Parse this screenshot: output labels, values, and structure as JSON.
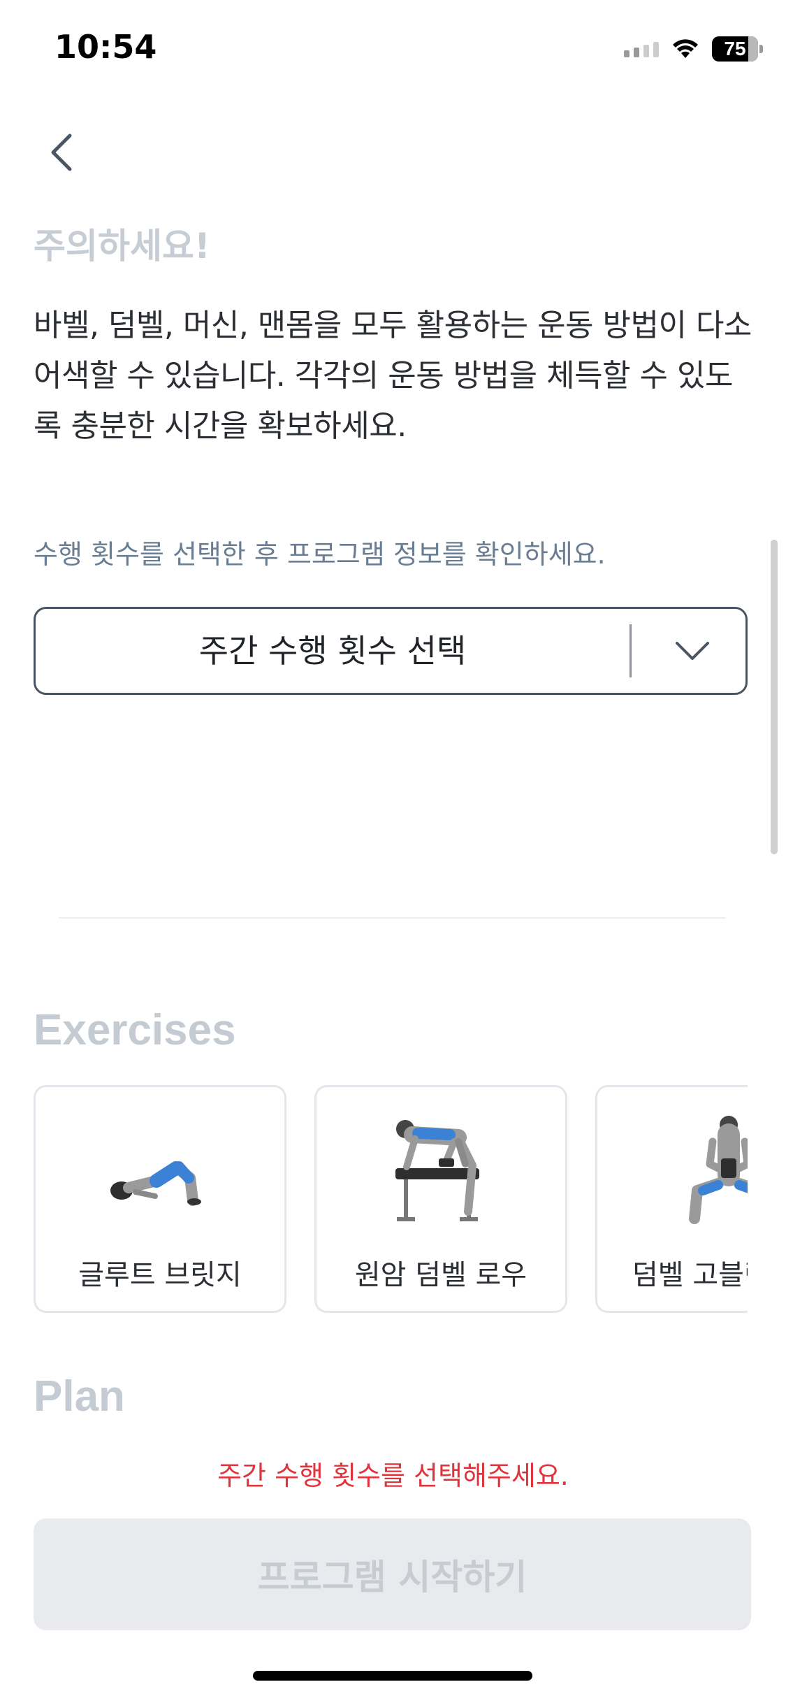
{
  "status_bar": {
    "time": "10:54",
    "battery": "75",
    "icons": [
      "cellular-signal-icon",
      "wifi-icon",
      "battery-icon"
    ]
  },
  "nav": {
    "back_icon": "chevron-left-icon"
  },
  "warning": {
    "title": "주의하세요!",
    "body": "바벨, 덤벨, 머신, 맨몸을 모두 활용하는 운동 방법이 다소 어색할 수 있습니다. 각각의 운동 방법을 체득할 수 있도록 충분한 시간을 확보하세요."
  },
  "frequency": {
    "hint": "수행 횟수를 선택한 후 프로그램 정보를 확인하세요.",
    "select_label": "주간 수행 횟수 선택",
    "select_icon": "chevron-down-icon"
  },
  "exercises": {
    "title": "Exercises",
    "items": [
      {
        "label": "글루트 브릿지",
        "icon": "glute-bridge-illustration"
      },
      {
        "label": "원암 덤벨 로우",
        "icon": "one-arm-dumbbell-row-illustration"
      },
      {
        "label": "덤벨 고블릿",
        "icon": "dumbbell-goblet-squat-illustration"
      }
    ]
  },
  "plan": {
    "title": "Plan",
    "error": "주간 수행 횟수를 선택해주세요.",
    "start_button": "프로그램 시작하기"
  },
  "colors": {
    "accent_error": "#e0343c",
    "muscle_highlight": "#3b82d6",
    "disabled_bg": "#e8eaed",
    "disabled_text": "#c6ccd2"
  }
}
